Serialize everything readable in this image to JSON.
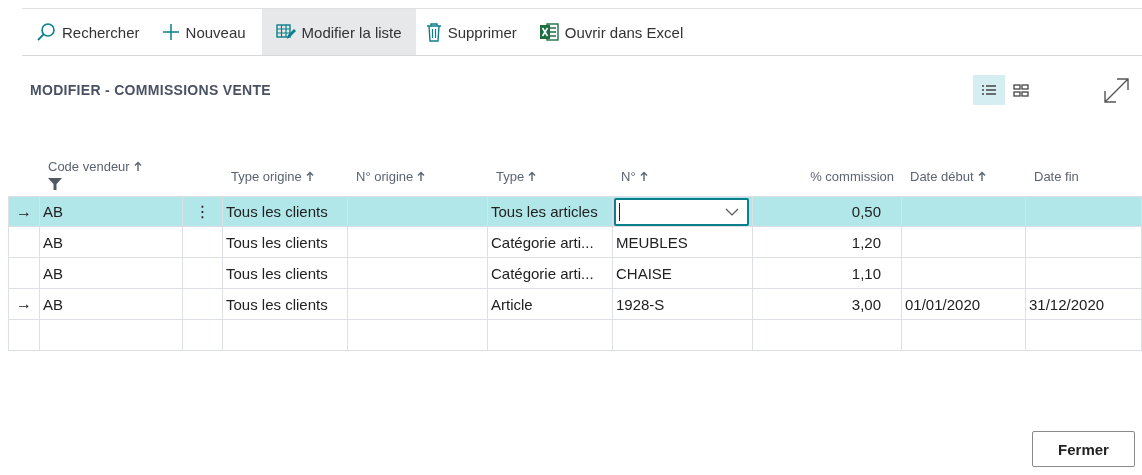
{
  "toolbar": [
    {
      "label": "Rechercher",
      "selected": false
    },
    {
      "label": "Nouveau",
      "selected": false
    },
    {
      "label": "Modifier la liste",
      "selected": true
    },
    {
      "label": "Supprimer",
      "selected": false
    },
    {
      "label": "Ouvrir dans Excel",
      "selected": false
    }
  ],
  "title": "MODIFIER - COMMISSIONS VENTE",
  "views": [
    {
      "kind": "list",
      "selected": true
    },
    {
      "kind": "tiles",
      "selected": false
    }
  ],
  "columns": [
    {
      "label": "Code vendeur",
      "sorted": true,
      "filtered": true,
      "kind": "text"
    },
    {
      "label": "Type origine",
      "sorted": true,
      "filtered": false,
      "kind": "text"
    },
    {
      "label": "N° origine",
      "sorted": true,
      "filtered": false,
      "kind": "text"
    },
    {
      "label": "Type",
      "sorted": true,
      "filtered": false,
      "kind": "text"
    },
    {
      "label": "N°",
      "sorted": true,
      "filtered": false,
      "kind": "text"
    },
    {
      "label": "% commission",
      "sorted": false,
      "filtered": false,
      "kind": "number"
    },
    {
      "label": "Date début",
      "sorted": true,
      "filtered": false,
      "kind": "text"
    },
    {
      "label": "Date fin",
      "sorted": false,
      "filtered": false,
      "kind": "text"
    }
  ],
  "rows": [
    {
      "marker": "→",
      "menu": "⋮",
      "selected": true,
      "cells": [
        "AB",
        "Tous les clients",
        null,
        "Tous les articles",
        {
          "kind": "dropdown"
        },
        "0,50",
        null,
        null
      ]
    },
    {
      "selected": false,
      "cells": [
        "AB",
        "Tous les clients",
        null,
        "Catégorie arti...",
        "MEUBLES",
        "1,20",
        null,
        null
      ]
    },
    {
      "selected": false,
      "cells": [
        "AB",
        "Tous les clients",
        null,
        "Catégorie arti...",
        "CHAISE",
        "1,10",
        null,
        null
      ]
    },
    {
      "marker": "→",
      "selected": false,
      "cells": [
        "AB",
        "Tous les clients",
        null,
        "Article",
        "1928-S",
        "3,00",
        "01/01/2020",
        "31/12/2020"
      ]
    },
    {
      "selected": false,
      "cells": [
        null,
        null,
        null,
        null,
        null,
        null,
        null,
        null
      ]
    }
  ],
  "close_button": "Fermer"
}
